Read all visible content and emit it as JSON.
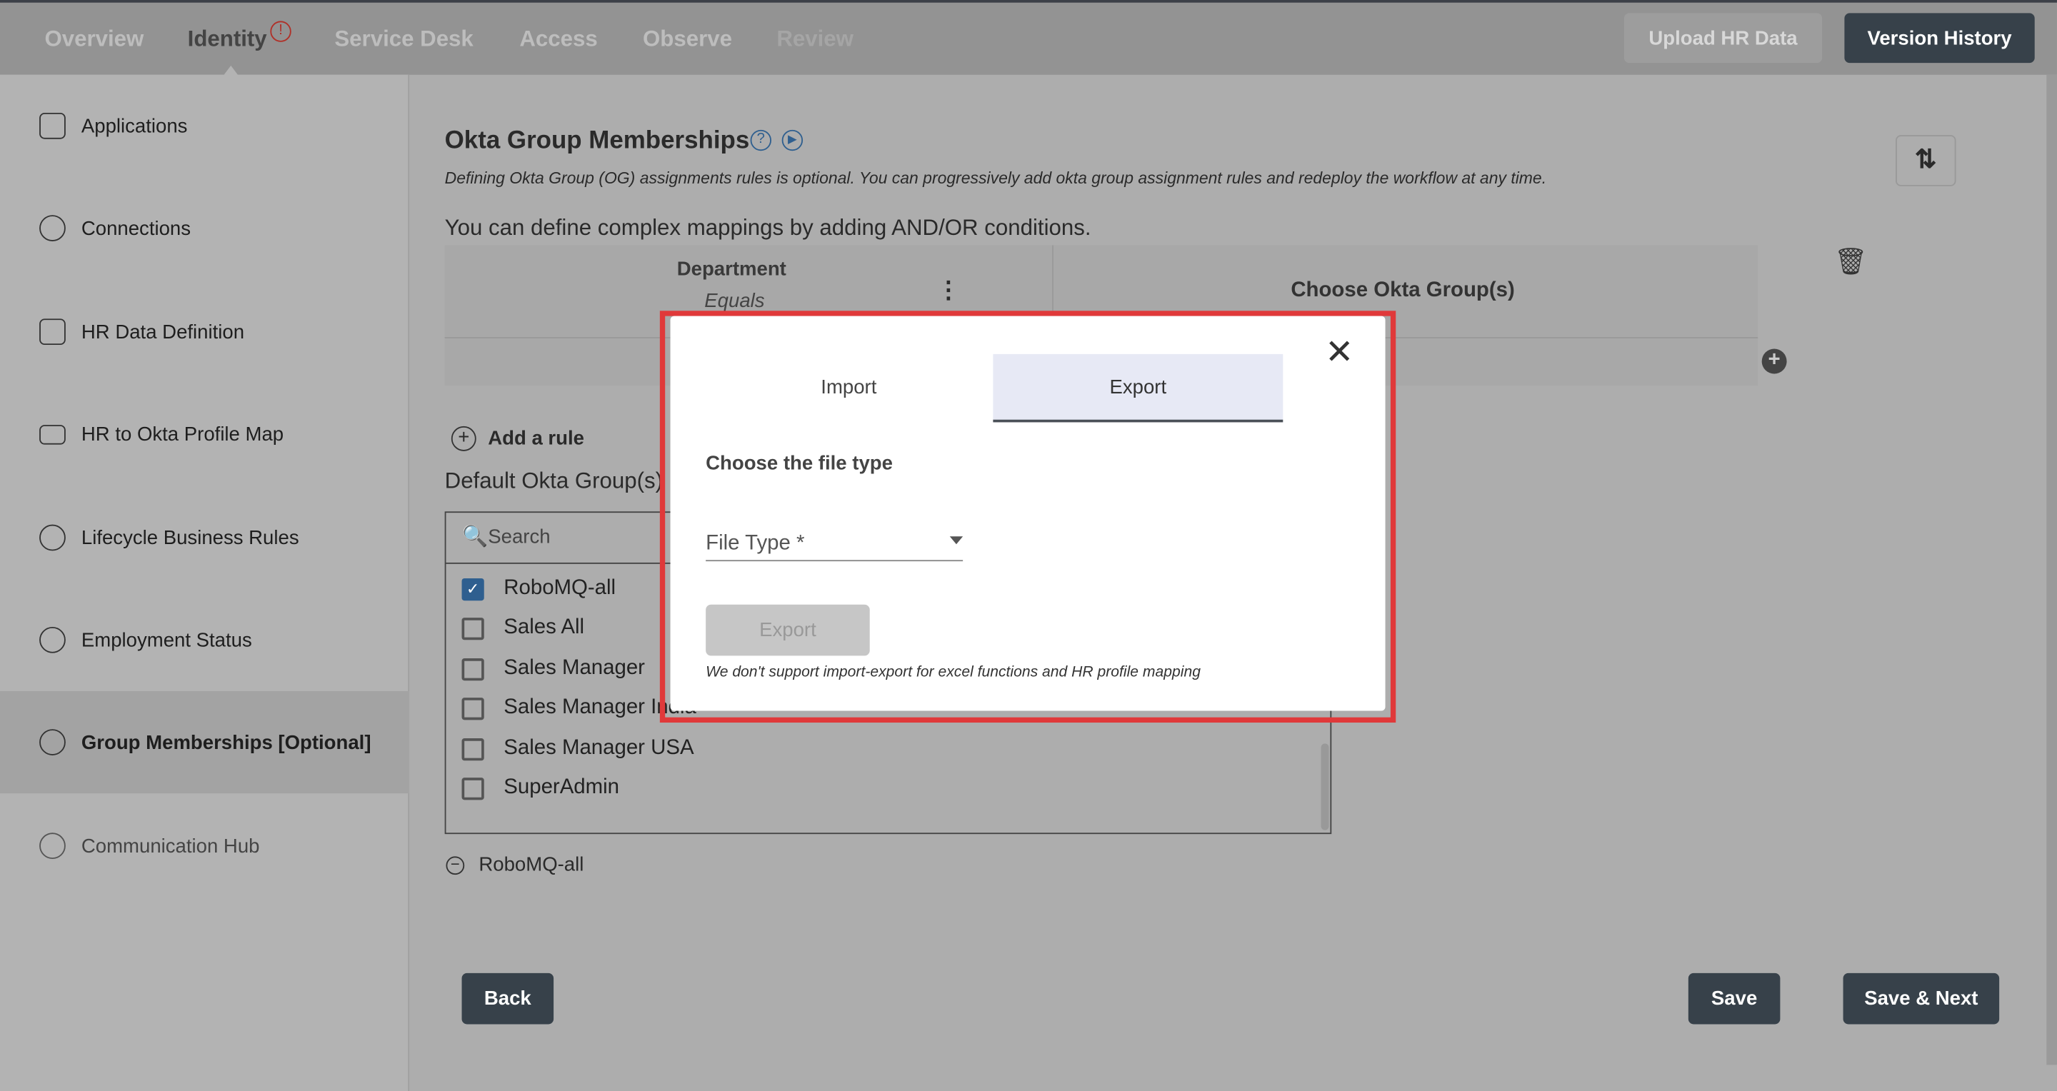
{
  "nav": {
    "tabs": [
      "Overview",
      "Identity",
      "Service Desk",
      "Access",
      "Observe",
      "Review"
    ],
    "active": "Identity",
    "upload_label": "Upload HR Data",
    "version_label": "Version History"
  },
  "sidebar": {
    "items": [
      "Applications",
      "Connections",
      "HR Data Definition",
      "HR to Okta Profile Map",
      "Lifecycle Business Rules",
      "Employment Status",
      "Group Memberships [Optional]",
      "Communication Hub"
    ],
    "active": "Group Memberships [Optional]"
  },
  "main": {
    "title": "Okta Group Memberships",
    "subtitle": "Defining Okta Group (OG) assignments rules is optional. You can progressively add okta group assignment rules and redeploy the workflow at any time.",
    "hint": "You can define complex mappings by adding AND/OR conditions.",
    "col1_title": "Department",
    "col1_op": "Equals",
    "col2_title": "Choose Okta Group(s)",
    "add_rule": "Add a rule",
    "default_label": "Default Okta Group(s)",
    "search_placeholder": "Search",
    "groups": [
      {
        "name": "RoboMQ-all",
        "checked": true
      },
      {
        "name": "Sales All",
        "checked": false
      },
      {
        "name": "Sales Manager",
        "checked": false
      },
      {
        "name": "Sales Manager India",
        "checked": false
      },
      {
        "name": "Sales Manager USA",
        "checked": false
      },
      {
        "name": "SuperAdmin",
        "checked": false
      }
    ],
    "selected_chip": "RoboMQ-all",
    "back": "Back",
    "save": "Save",
    "save_next": "Save & Next"
  },
  "dialog": {
    "tabs": [
      "Import",
      "Export"
    ],
    "active_tab": "Export",
    "heading": "Choose the file type",
    "field_label": "File Type *",
    "button": "Export",
    "note": "We don't support import-export for excel functions and HR profile mapping"
  },
  "colors": {
    "dark_button": "#37414a",
    "accent_blue": "#2f5f8f",
    "highlight_red": "#e0393a"
  }
}
